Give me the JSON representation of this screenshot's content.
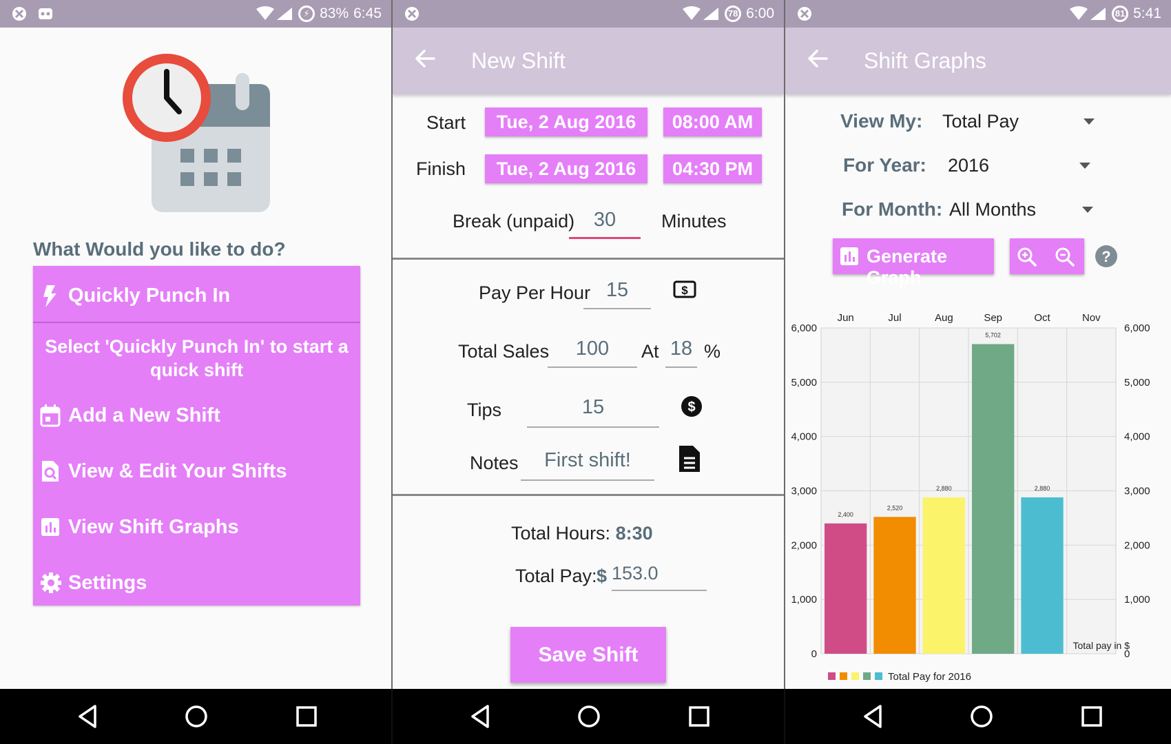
{
  "colors": {
    "accent": "#e47ff8",
    "statusbar": "#a89cb3",
    "appbar": "#d1c5d9",
    "label": "#5a6e7a",
    "underline_active": "#e0457a"
  },
  "home": {
    "status": {
      "battery": "83%",
      "time": "6:45"
    },
    "question": "What Would you like to do?",
    "menu": {
      "punch_in": "Quickly Punch In",
      "hint": "Select 'Quickly Punch In' to start a quick shift",
      "add_shift": "Add a New Shift",
      "view_edit": "View & Edit Your Shifts",
      "graphs": "View Shift Graphs",
      "settings": "Settings"
    }
  },
  "new_shift": {
    "status": {
      "time": "6:00",
      "badge": "78"
    },
    "title": "New Shift",
    "start_label": "Start",
    "start_date": "Tue, 2 Aug 2016",
    "start_time": "08:00 AM",
    "finish_label": "Finish",
    "finish_date": "Tue, 2 Aug 2016",
    "finish_time": "04:30 PM",
    "break_label": "Break (unpaid)",
    "break_value": "30",
    "break_unit": "Minutes",
    "pay_label": "Pay Per Hour",
    "pay_value": "15",
    "sales_label": "Total Sales",
    "sales_value": "100",
    "at_label": "At",
    "percent_value": "18",
    "percent_sign": "%",
    "tips_label": "Tips",
    "tips_value": "15",
    "notes_label": "Notes",
    "notes_value": "First shift!",
    "total_hours_label": "Total Hours:",
    "total_hours_value": "8:30",
    "total_pay_label": "Total Pay:",
    "total_pay_currency": "$",
    "total_pay_value": "153.0",
    "save_button": "Save Shift"
  },
  "graphs": {
    "status": {
      "time": "5:41",
      "badge": "81"
    },
    "title": "Shift Graphs",
    "view_label": "View My:",
    "view_value": "Total Pay",
    "year_label": "For Year:",
    "year_value": "2016",
    "month_label": "For Month:",
    "month_value": "All Months",
    "generate_button": "Generate Graph"
  },
  "chart_data": {
    "type": "bar",
    "categories": [
      "Jun",
      "Jul",
      "Aug",
      "Sep",
      "Oct",
      "Nov"
    ],
    "values": [
      2400,
      2520,
      2880,
      5702,
      2880,
      null
    ],
    "value_labels": [
      "2,400",
      "2,520",
      "2,880",
      "5,702",
      "2,880",
      ""
    ],
    "colors": [
      "#d04c87",
      "#f28c00",
      "#fbf36a",
      "#6fa986",
      "#4cbdd1"
    ],
    "ylim": [
      0,
      6000
    ],
    "yticks": [
      0,
      1000,
      2000,
      3000,
      4000,
      5000,
      6000
    ],
    "ytick_labels": [
      "0",
      "1,000",
      "2,000",
      "3,000",
      "4,000",
      "5,000",
      "6,000"
    ],
    "xaxis_position": "top",
    "grid": true,
    "description": "Total pay in $",
    "legend": "Total Pay for 2016",
    "legend_placement": "bottom-left"
  }
}
